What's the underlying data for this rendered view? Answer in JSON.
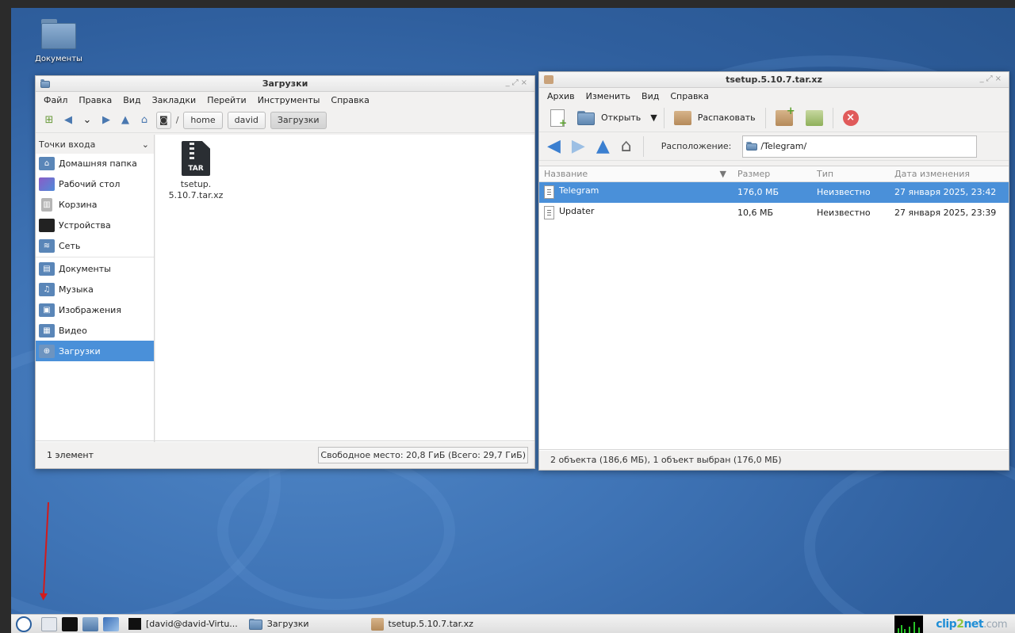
{
  "desktop": {
    "icons": [
      {
        "label": "Документы",
        "icon": "folder-documents-icon"
      }
    ]
  },
  "file_manager": {
    "title": "Загрузки",
    "menu": [
      "Файл",
      "Правка",
      "Вид",
      "Закладки",
      "Перейти",
      "Инструменты",
      "Справка"
    ],
    "breadcrumb": {
      "root_sep": "/",
      "items": [
        "home",
        "david",
        "Загрузки"
      ]
    },
    "sidebar": {
      "header": "Точки входа",
      "groups": [
        [
          {
            "label": "Домашняя папка",
            "icon": "home-folder-icon",
            "color": "#5a86b8"
          },
          {
            "label": "Рабочий стол",
            "icon": "desktop-icon",
            "color": "#8a5cc7"
          },
          {
            "label": "Корзина",
            "icon": "trash-icon",
            "color": "#9a9a9a"
          },
          {
            "label": "Устройства",
            "icon": "computer-icon",
            "color": "#222222"
          },
          {
            "label": "Сеть",
            "icon": "network-icon",
            "color": "#5a86b8"
          }
        ],
        [
          {
            "label": "Документы",
            "icon": "documents-folder-icon",
            "color": "#5a86b8"
          },
          {
            "label": "Музыка",
            "icon": "music-folder-icon",
            "color": "#5a86b8"
          },
          {
            "label": "Изображения",
            "icon": "pictures-folder-icon",
            "color": "#5a86b8"
          },
          {
            "label": "Видео",
            "icon": "videos-folder-icon",
            "color": "#5a86b8"
          },
          {
            "label": "Загрузки",
            "icon": "downloads-folder-icon",
            "color": "#5a86b8",
            "selected": true
          }
        ]
      ]
    },
    "files": [
      {
        "name_line1": "tsetup.",
        "name_line2": "5.10.7.tar.xz",
        "badge": "TAR"
      }
    ],
    "status": {
      "count": "1 элемент",
      "free": "Свободное место: 20,8 ГиБ (Всего: 29,7 ГиБ)"
    }
  },
  "archive_manager": {
    "title": "tsetup.5.10.7.tar.xz",
    "menu": [
      "Архив",
      "Изменить",
      "Вид",
      "Справка"
    ],
    "toolbar": {
      "open_label": "Открыть",
      "extract_label": "Распаковать"
    },
    "location": {
      "label": "Расположение:",
      "value": "/Telegram/"
    },
    "columns": {
      "name": "Название",
      "size": "Размер",
      "type": "Тип",
      "modified": "Дата изменения"
    },
    "rows": [
      {
        "name": "Telegram",
        "size": "176,0 МБ",
        "type": "Неизвестно",
        "modified": "27 января 2025, 23:42",
        "selected": true
      },
      {
        "name": "Updater",
        "size": "10,6 МБ",
        "type": "Неизвестно",
        "modified": "27 января 2025, 23:39",
        "selected": false
      }
    ],
    "status": "2 объекта (186,6 МБ), 1 объект выбран (176,0 МБ)"
  },
  "taskbar": {
    "tasks": [
      {
        "label": "[david@david-Virtu...",
        "icon": "terminal-icon"
      },
      {
        "label": "Загрузки",
        "icon": "folder-icon"
      },
      {
        "label": "tsetup.5.10.7.tar.xz",
        "icon": "archive-icon"
      }
    ],
    "tray": {
      "brand_a": "clip",
      "brand_b": "2",
      "brand_c": "net",
      "brand_d": ".com"
    }
  },
  "colors": {
    "selection": "#4a90d9",
    "desktop": "#3f74b6",
    "annotation_arrow": "#d21b1b"
  }
}
